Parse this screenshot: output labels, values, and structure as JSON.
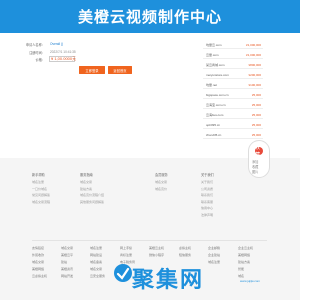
{
  "banner": {
    "title": "美橙云视频制作中心"
  },
  "form": {
    "rows": [
      {
        "label": "申请人名称：",
        "value": "Overall ()"
      },
      {
        "label": "注册时间：",
        "value": "2022/7/1 10:41:35"
      },
      {
        "label": "价格：",
        "value": "¥ 1,00.0000元"
      }
    ],
    "buttons": {
      "login": "立即登录",
      "back": "返回首页"
    }
  },
  "domains": [
    {
      "name": "坑量云.com",
      "price": "¥1,000,000"
    },
    {
      "name": "云量.com",
      "price": "¥1,000,000"
    },
    {
      "name": "某云商城.com",
      "price": "¥800,000"
    },
    {
      "name": "meiyunstore.com",
      "price": "¥200,000"
    },
    {
      "name": "坑量.net",
      "price": "¥100,000"
    },
    {
      "name": "bigspace.com.cn",
      "price": "¥5,000"
    },
    {
      "name": "云海宝.com.cn",
      "price": "¥5,000"
    },
    {
      "name": "云海bus.com",
      "price": "¥5,000"
    },
    {
      "name": "qoh095.cn",
      "price": "¥5,000"
    },
    {
      "name": "zhanJ35.cn",
      "price": "¥5,000"
    }
  ],
  "side": {
    "icon": "收藏",
    "lines": [
      "添加",
      "收藏",
      "图片"
    ]
  },
  "footer_links": [
    {
      "head": "新手帮助",
      "items": [
        "域名注册",
        "一口价域名",
        "常见问题解答",
        "域名交易流程"
      ]
    },
    {
      "head": "服务指南",
      "items": [
        "域名交易",
        "建站方案",
        "域名竞价流程介绍",
        "其他服务问题解答"
      ]
    },
    {
      "head": "会员服务",
      "items": [
        "域名交易",
        "域名竞价"
      ]
    },
    {
      "head": "关于我们",
      "items": [
        "关于我们",
        "公司资质",
        "联系我们",
        "联系客服",
        "信用中心",
        "法律声明"
      ]
    }
  ],
  "grid": {
    "rows": [
      [
        "友情链接",
        "域名交易",
        "域名注册",
        "网上手续",
        "美橙云主机",
        "虚拟主机",
        "企业邮箱",
        "企业云主机"
      ],
      [
        "外贸收款",
        "美橙云平",
        "网站建设",
        "商标注册",
        "微信小程序",
        "短信服务",
        "企业建站",
        "美橙网络"
      ],
      [
        "域名交易",
        "建站",
        "域名备案",
        "电子税务局",
        "人才招聘",
        "云服务器",
        "域名注册",
        "建站方案"
      ],
      [
        "美橙网络",
        "美橙资讯",
        "域名交易",
        "香港云主机",
        "美橙云主机",
        "云服务器推广",
        "广州服务器",
        "智能"
      ],
      [
        "云虚拟主机",
        "网站开发",
        "云安全服务",
        "网站推广",
        "企业邮箱",
        "微信服务",
        "网站建设",
        "域名"
      ]
    ]
  },
  "watermark": {
    "text": "聚集网",
    "url": "www.jujijw.com"
  }
}
